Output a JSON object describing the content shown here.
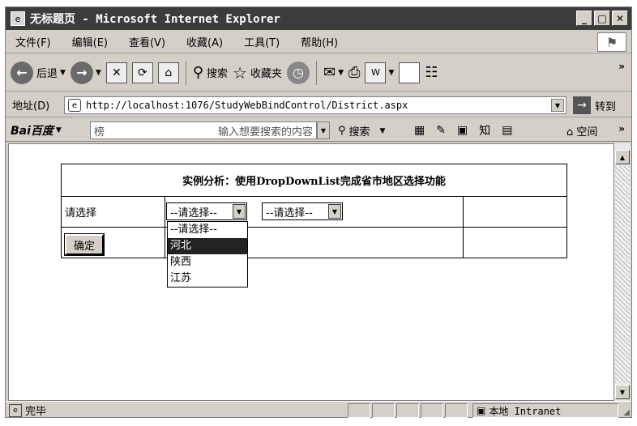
{
  "window": {
    "title": "无标题页 - Microsoft Internet Explorer",
    "minimize": "_",
    "maximize": "□",
    "close": "✕"
  },
  "menubar": {
    "items": [
      "文件(F)",
      "编辑(E)",
      "查看(V)",
      "收藏(A)",
      "工具(T)",
      "帮助(H)"
    ]
  },
  "toolbar": {
    "back_label": "后退",
    "search_label": "搜索",
    "favorites_label": "收藏夹",
    "more": "»"
  },
  "addressbar": {
    "label": "地址(D)",
    "url": "http://localhost:1076/StudyWebBindControl/District.aspx",
    "go_label": "转到"
  },
  "baidubar": {
    "logo": "Bai百度",
    "input_prefix": "榜",
    "input_placeholder": "输入想要搜索的内容",
    "search_label": "搜索",
    "space_label": "空间",
    "more": "»"
  },
  "page": {
    "heading": "实例分析：使用DropDownList完成省市地区选择功能",
    "prompt_label": "请选择",
    "province_select_value": "--请选择--",
    "city_select_value": "--请选择--",
    "province_options": [
      "--请选择--",
      "河北",
      "陕西",
      "江苏"
    ],
    "highlighted_option_index": 1,
    "ok_button_label": "确定"
  },
  "statusbar": {
    "status_text": "完毕",
    "zone_text": "本地 Intranet"
  }
}
